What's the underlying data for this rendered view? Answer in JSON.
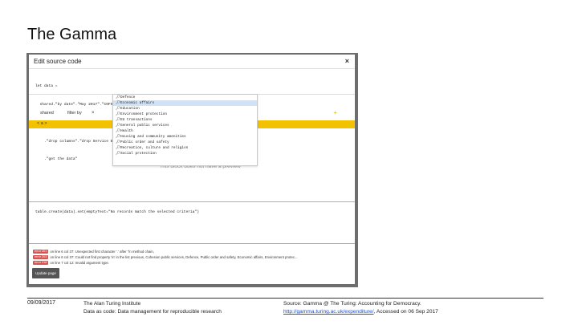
{
  "slide": {
    "title": "The Gamma",
    "date": "09/09/2017",
    "org": "The Alan Turing Institute",
    "subtitle": "Data as code: Data management for reproducible research",
    "source_prefix": "Source: Gamma @ The Turing: Accounting for Democracy.",
    "source_link": "http://gamma.turing.ac.uk/expenditure/",
    "source_suffix": ", Accessed on 06 Sep 2017"
  },
  "modal": {
    "title": "Edit source code",
    "close": "×",
    "code_lines": [
      "let data =",
      "  shared.\"by date\".\"May 2017\".\"COFOG Structure\"",
      "    .\"filter data\".\"Service is\".| Defe",
      "    .\"drop columns\".\"drop Service Expenditure\"",
      "    .\"get the data\""
    ],
    "toolbar": {
      "shared": "shared",
      "filter_by": "filter by",
      "remove": "×",
      "add": "+"
    },
    "yellow_bar_text": "< a >",
    "preview_text": "This block does not have a preview",
    "code2": "table.create(data).set(emptyText=\"No records match the selected criteria\")",
    "errors": [
      {
        "badge": "error 201",
        "text": "on line 6 col 37: Unexpected first character '.' after \"in method chain,"
      },
      {
        "badge": "error 203",
        "text": "on line 6 col 37: Could not find property 'in' in the list previous, Cohesion public services, Defence, Public order and safety, Economic affairs, Environment protec..."
      },
      {
        "badge": "error 218",
        "text": "on line 7 col 12: Invalid argument type."
      }
    ],
    "update_button": "Update page"
  },
  "dropdown": {
    "selected_index": 1,
    "items": [
      "Defence",
      "Economic affairs",
      "Education",
      "Environment protection",
      "EU transactions",
      "General public services",
      "Health",
      "Housing and community amenities",
      "Public order and safety",
      "Recreation, culture and religion",
      "Social protection"
    ]
  },
  "colors": {
    "accent": "#f2c100",
    "error": "#d9534f",
    "selected": "#cfe3f8",
    "link": "#1a4fd0"
  }
}
